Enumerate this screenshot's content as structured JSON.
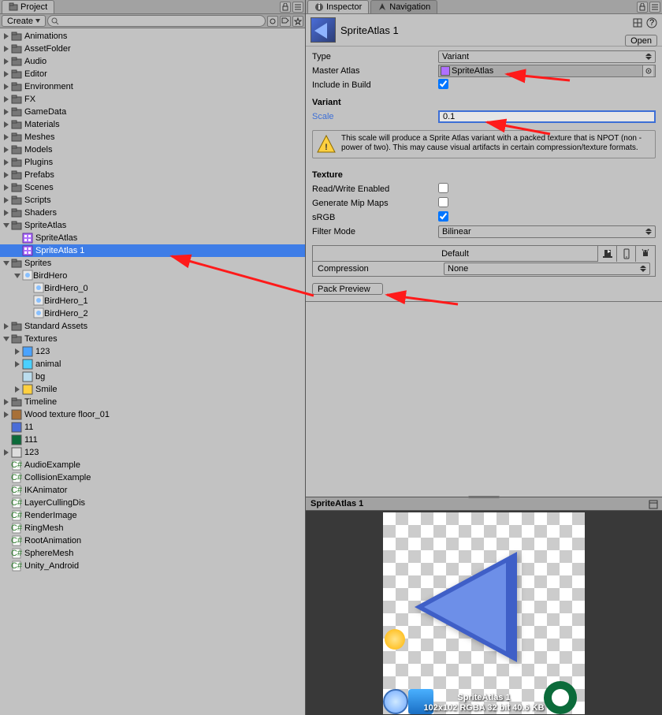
{
  "tabs": {
    "project": "Project",
    "inspector": "Inspector",
    "navigation": "Navigation"
  },
  "project": {
    "create": "Create",
    "search_placeholder": ""
  },
  "tree": [
    {
      "d": 0,
      "t": "folder",
      "fold": "closed",
      "label": "Animations"
    },
    {
      "d": 0,
      "t": "folder",
      "fold": "closed",
      "label": "AssetFolder"
    },
    {
      "d": 0,
      "t": "folder",
      "fold": "closed",
      "label": "Audio"
    },
    {
      "d": 0,
      "t": "folder",
      "fold": "closed",
      "label": "Editor"
    },
    {
      "d": 0,
      "t": "folder",
      "fold": "closed",
      "label": "Environment"
    },
    {
      "d": 0,
      "t": "folder",
      "fold": "closed",
      "label": "FX"
    },
    {
      "d": 0,
      "t": "folder",
      "fold": "closed",
      "label": "GameData"
    },
    {
      "d": 0,
      "t": "folder",
      "fold": "closed",
      "label": "Materials"
    },
    {
      "d": 0,
      "t": "folder",
      "fold": "closed",
      "label": "Meshes"
    },
    {
      "d": 0,
      "t": "folder",
      "fold": "closed",
      "label": "Models"
    },
    {
      "d": 0,
      "t": "folder",
      "fold": "closed",
      "label": "Plugins"
    },
    {
      "d": 0,
      "t": "folder",
      "fold": "closed",
      "label": "Prefabs"
    },
    {
      "d": 0,
      "t": "folder",
      "fold": "closed",
      "label": "Scenes"
    },
    {
      "d": 0,
      "t": "folder",
      "fold": "closed",
      "label": "Scripts"
    },
    {
      "d": 0,
      "t": "folder",
      "fold": "closed",
      "label": "Shaders"
    },
    {
      "d": 0,
      "t": "folder",
      "fold": "open",
      "label": "SpriteAtlas"
    },
    {
      "d": 1,
      "t": "atlas",
      "fold": "none",
      "label": "SpriteAtlas"
    },
    {
      "d": 1,
      "t": "atlas",
      "fold": "none",
      "label": "SpriteAtlas 1",
      "selected": true
    },
    {
      "d": 0,
      "t": "folder",
      "fold": "open",
      "label": "Sprites"
    },
    {
      "d": 1,
      "t": "sprite",
      "fold": "open",
      "label": "BirdHero"
    },
    {
      "d": 2,
      "t": "sprite",
      "fold": "none",
      "label": "BirdHero_0"
    },
    {
      "d": 2,
      "t": "sprite",
      "fold": "none",
      "label": "BirdHero_1"
    },
    {
      "d": 2,
      "t": "sprite",
      "fold": "none",
      "label": "BirdHero_2"
    },
    {
      "d": 0,
      "t": "folder",
      "fold": "closed",
      "label": "Standard Assets"
    },
    {
      "d": 0,
      "t": "folder",
      "fold": "open",
      "label": "Textures"
    },
    {
      "d": 1,
      "t": "img",
      "fold": "closed",
      "label": "123",
      "color": "#4aa3ff"
    },
    {
      "d": 1,
      "t": "img",
      "fold": "closed",
      "label": "animal",
      "color": "#4ad0ff"
    },
    {
      "d": 1,
      "t": "img",
      "fold": "none",
      "label": "bg",
      "color": "#bde"
    },
    {
      "d": 1,
      "t": "img",
      "fold": "closed",
      "label": "Smile",
      "color": "#ffd040"
    },
    {
      "d": 0,
      "t": "folder",
      "fold": "closed",
      "label": "Timeline"
    },
    {
      "d": 0,
      "t": "img",
      "fold": "closed",
      "label": "Wood texture floor_01",
      "color": "#a87038"
    },
    {
      "d": 0,
      "t": "img",
      "fold": "none",
      "label": "11",
      "color": "#4a6dd8"
    },
    {
      "d": 0,
      "t": "img",
      "fold": "none",
      "label": "111",
      "color": "#0b6b3a"
    },
    {
      "d": 0,
      "t": "img",
      "fold": "closed",
      "label": "123",
      "color": "#ddd"
    },
    {
      "d": 0,
      "t": "cs",
      "fold": "none",
      "label": "AudioExample"
    },
    {
      "d": 0,
      "t": "cs",
      "fold": "none",
      "label": "CollisionExample"
    },
    {
      "d": 0,
      "t": "cs",
      "fold": "none",
      "label": "IKAnimator"
    },
    {
      "d": 0,
      "t": "cs",
      "fold": "none",
      "label": "LayerCullingDis"
    },
    {
      "d": 0,
      "t": "cs",
      "fold": "none",
      "label": "RenderImage"
    },
    {
      "d": 0,
      "t": "cs",
      "fold": "none",
      "label": "RingMesh"
    },
    {
      "d": 0,
      "t": "cs",
      "fold": "none",
      "label": "RootAnimation"
    },
    {
      "d": 0,
      "t": "cs",
      "fold": "none",
      "label": "SphereMesh"
    },
    {
      "d": 0,
      "t": "cs",
      "fold": "none",
      "label": "Unity_Android"
    }
  ],
  "inspector": {
    "title": "SpriteAtlas 1",
    "open_btn": "Open",
    "type_label": "Type",
    "type_value": "Variant",
    "master_label": "Master Atlas",
    "master_value": "SpriteAtlas",
    "include_label": "Include in Build",
    "include_checked": true,
    "variant_h": "Variant",
    "scale_label": "Scale",
    "scale_value": "0.1",
    "help_text": "This scale will produce a Sprite Atlas variant with a packed texture that is NPOT (non - power of two). This may cause visual artifacts in certain compression/texture formats.",
    "texture_h": "Texture",
    "rw_label": "Read/Write Enabled",
    "rw_checked": false,
    "mip_label": "Generate Mip Maps",
    "mip_checked": false,
    "srgb_label": "sRGB",
    "srgb_checked": true,
    "filter_label": "Filter Mode",
    "filter_value": "Bilinear",
    "platform_default": "Default",
    "compression_label": "Compression",
    "compression_value": "None",
    "pack_btn": "Pack Preview"
  },
  "preview": {
    "title": "SpriteAtlas 1",
    "caption_line1": "SpriteAtlas 1",
    "caption_line2": "102x102 RGBA 32 bit   40.6 KB"
  }
}
